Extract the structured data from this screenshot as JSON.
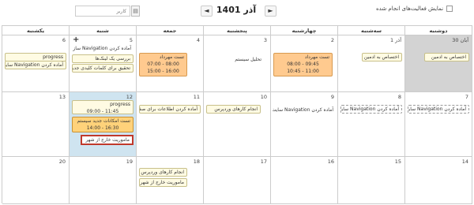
{
  "toolbar": {
    "show_done_label": "نمایش فعالیت‌های انجام شده",
    "month_label": "آذر 1401",
    "prev_icon": "chevron-left",
    "next_icon": "chevron-right",
    "user_placeholder": "کاربر"
  },
  "weekdays": [
    "دوشنبه",
    "سه‌شنبه",
    "چهارشنبه",
    "پنجشنبه",
    "جمعه",
    "شنبه",
    "یکشنبه"
  ],
  "days": {
    "r1": [
      "30 آبان",
      "1 آذر",
      "2",
      "3",
      "4",
      "5",
      "6"
    ],
    "r2": [
      "7",
      "8",
      "9",
      "10",
      "11",
      "12",
      "13"
    ],
    "r3": [
      "14",
      "15",
      "16",
      "17",
      "18",
      "19",
      "20"
    ]
  },
  "events": {
    "mon30_a": "اختصاص به ادمین",
    "tue1_a": "اختصاص به ادمین",
    "wed2_title": "تست مهرداد",
    "wed2_t1": "08:00 - 09:45",
    "wed2_t2": "10:45 - 11:00",
    "thu3_a": "تحلیل سیستم",
    "fri4_title": "تست مهرداد",
    "fri4_t1": "07:00 - 08:00",
    "fri4_t2": "15:00 - 16:00",
    "sat5_a": "آماده کردن Navigation ساز",
    "sat5_b": "بررسی یک لینک‌ها",
    "sat5_c": "تحقیق برای کلمات کلیدی جدید",
    "sun6_a": "progress",
    "sun6_b": "آماده کردن Navigation سایت",
    "mon7_a": "آماده کردن Navigation سایت",
    "tue8_a": "آماده کردن Navigation سایت",
    "wed9_a": "آماده کردن Navigation سایت ...",
    "thu10_a": "انجام کارهای وردپرس",
    "fri11_a": "آماده کردن اطلاعات برای صفحه",
    "sat12_a": "progress",
    "sat12_t": "09:00 - 11:45",
    "sat12_b": "تست امکانات جدید سیستم",
    "sat12_t2": "14:00 - 16:30",
    "sat12_c": "ماموریت خارج از شهر",
    "fri18_a": "انجام کارهای وردپرس",
    "fri18_b": "ماموریت خارج از شهر"
  }
}
